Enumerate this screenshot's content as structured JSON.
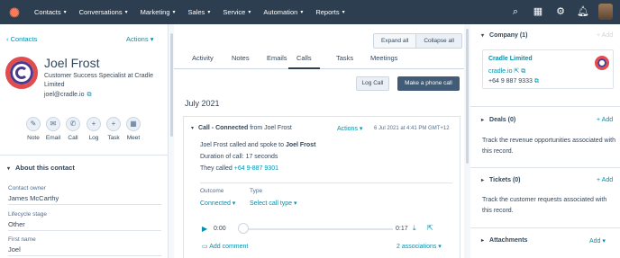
{
  "nav": {
    "items": [
      "Contacts",
      "Conversations",
      "Marketing",
      "Sales",
      "Service",
      "Automation",
      "Reports"
    ]
  },
  "contact": {
    "back": "Contacts",
    "actions": "Actions",
    "name": "Joel Frost",
    "title": "Customer Success Specialist at Cradle Limited",
    "email": "joel@cradle.io",
    "quick_actions": [
      "Note",
      "Email",
      "Call",
      "Log",
      "Task",
      "Meet"
    ],
    "about_heading": "About this contact",
    "fields": [
      {
        "label": "Contact owner",
        "value": "James McCarthy"
      },
      {
        "label": "Lifecycle stage",
        "value": "Other"
      },
      {
        "label": "First name",
        "value": "Joel"
      }
    ]
  },
  "activity": {
    "expand_all": "Expand all",
    "collapse_all": "Collapse all",
    "tabs": [
      "Activity",
      "Notes",
      "Emails",
      "Calls",
      "Tasks",
      "Meetings"
    ],
    "active_tab": "Calls",
    "log_call": "Log Call",
    "make_call": "Make a phone call",
    "month": "July 2021",
    "call": {
      "title_bold": "Call - Connected",
      "title_rest": " from Joel Frost",
      "actions": "Actions",
      "date": "6 Jul 2021 at 4:41 PM GMT+12",
      "line1_prefix": "Joel Frost called and spoke to ",
      "line1_bold": "Joel Frost",
      "line2": "Duration of call: 17 seconds",
      "line3_prefix": "They called ",
      "line3_link": "+64 9-887 9301",
      "outcome_label": "Outcome",
      "outcome_value": "Connected",
      "type_label": "Type",
      "type_value": "Select call type",
      "time_start": "0:00",
      "time_end": "0:17",
      "add_comment": "Add comment",
      "associations": "2 associations"
    }
  },
  "sidebar": {
    "company": {
      "heading": "Company (1)",
      "add": "+ Add",
      "name": "Cradle Limited",
      "domain": "cradle.io",
      "phone": "+64 9 887 9333"
    },
    "deals": {
      "heading": "Deals (0)",
      "add": "+ Add",
      "text": "Track the revenue opportunities associated with this record."
    },
    "tickets": {
      "heading": "Tickets (0)",
      "add": "+ Add",
      "text": "Track the customer requests associated with this record."
    },
    "attachments": {
      "heading": "Attachments",
      "add": "Add"
    }
  }
}
